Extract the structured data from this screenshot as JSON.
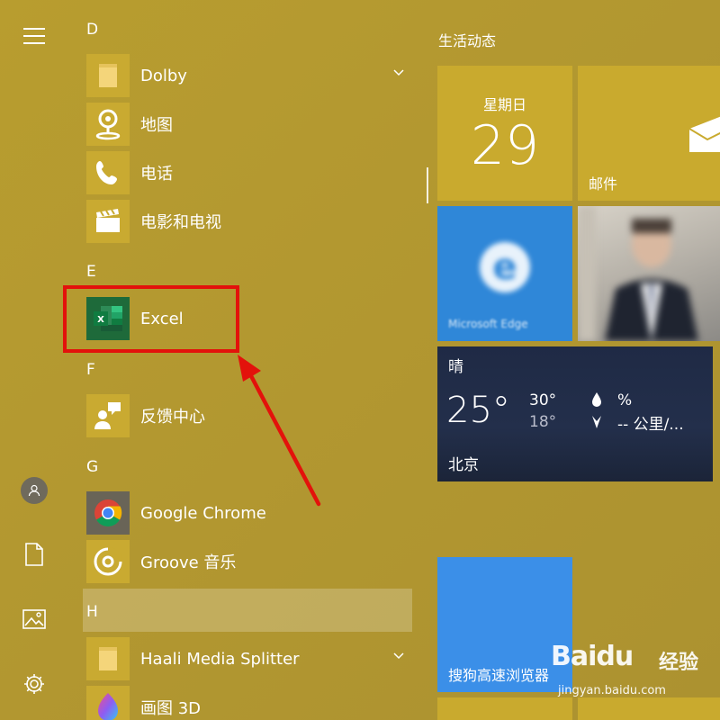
{
  "rail": {
    "menu_icon": "hamburger-icon",
    "user_icon": "user-icon",
    "documents_icon": "document-icon",
    "pictures_icon": "picture-icon",
    "settings_icon": "gear-icon"
  },
  "app_list": {
    "section_d": "D",
    "dolby": "Dolby",
    "maps": "地图",
    "phone": "电话",
    "movies_tv": "电影和电视",
    "section_e": "E",
    "excel": "Excel",
    "section_f": "F",
    "feedback_hub": "反馈中心",
    "section_g": "G",
    "google_chrome": "Google Chrome",
    "groove_music": "Groove 音乐",
    "section_h": "H",
    "haali_media_splitter": "Haali Media Splitter",
    "paint_3d": "画图 3D"
  },
  "tiles": {
    "section_title": "生活动态",
    "calendar": {
      "weekday": "星期日",
      "day": "29"
    },
    "mail": {
      "label": "邮件"
    },
    "edge": {
      "label": "Microsoft Edge"
    },
    "weather": {
      "condition": "晴",
      "temperature": "25°",
      "high": "30°",
      "low": "18°",
      "humidity": "%",
      "wind": "-- 公里/...",
      "city": "北京"
    },
    "sogou": {
      "label": "搜狗高速浏览器"
    }
  },
  "watermark": {
    "brand": "Baidu",
    "cn": "经验",
    "url": "jingyan.baidu.com"
  },
  "colors": {
    "background": "#b59a2e",
    "tile_gold": "#c9aa2e",
    "highlight_red": "#e3120b",
    "edge_blue": "#2f87d8",
    "sogou_blue": "#3b8fe8",
    "excel_green": "#1e6a3a"
  }
}
